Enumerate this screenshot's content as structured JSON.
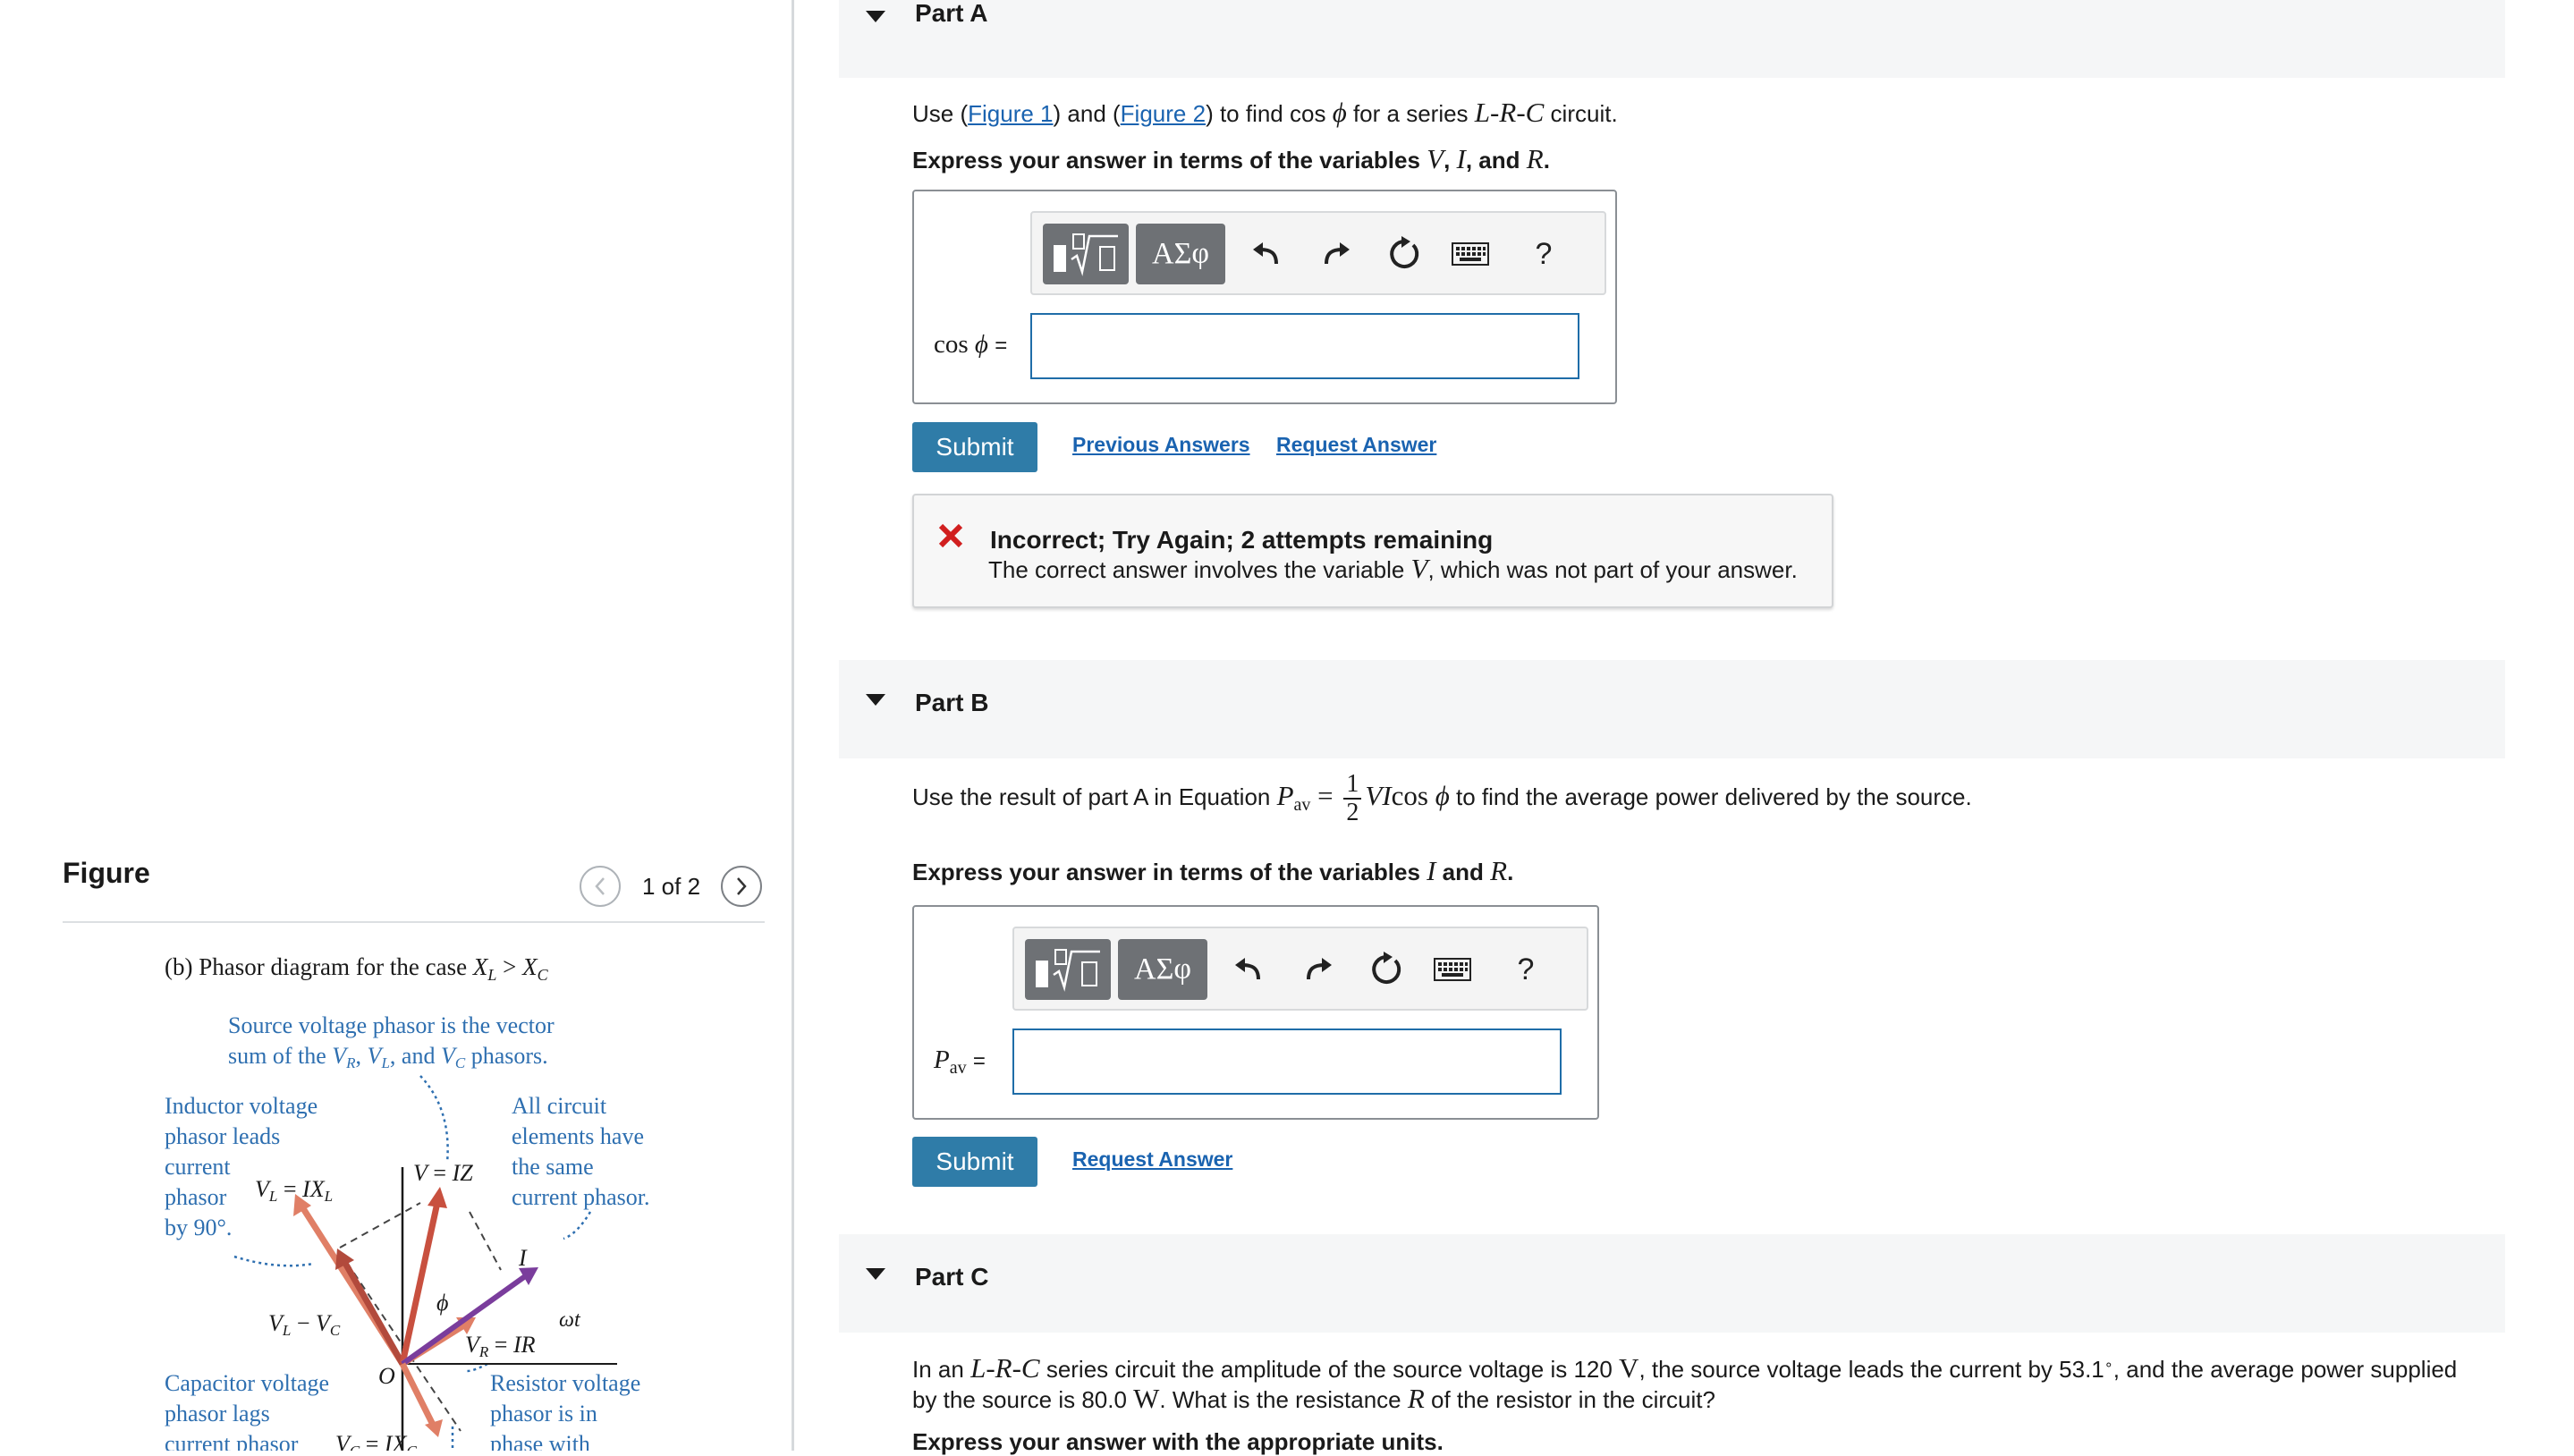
{
  "figure": {
    "title": "Figure",
    "page_count": "1 of 2",
    "caption_prefix": "(b) Phasor diagram for the case ",
    "caption_math": "X_L > X_C",
    "source_note_line1": "Source voltage phasor is the vector",
    "source_note_line2": "sum of the V_R, V_L, and V_C phasors.",
    "inductor_note": [
      "Inductor voltage",
      "phasor leads",
      "current",
      "phasor",
      "by 90°."
    ],
    "all_circuit_note": [
      "All circuit",
      "elements have",
      "the same",
      "current phasor."
    ],
    "capacitor_note": [
      "Capacitor voltage",
      "phasor lags",
      "current phasor"
    ],
    "resistor_note": [
      "Resistor voltage",
      "phasor is in",
      "phase with"
    ],
    "label_VL": "V_L = IX_L",
    "label_V": "V = IZ",
    "label_VLVC": "V_L − V_C",
    "label_VR": "V_R = IR",
    "label_VC": "V_C = IX_C",
    "label_I": "I",
    "label_phi": "ϕ",
    "label_wt": "ωt",
    "label_O": "O"
  },
  "partA": {
    "label": "Part A",
    "question_pre": "Use (",
    "fig1_link": "Figure 1",
    "question_mid": ") and (",
    "fig2_link": "Figure 2",
    "question_post": ") to find cos ϕ for a series L-R-C circuit.",
    "instruction": "Express your answer in terms of the variables V, I, and R.",
    "input_label": "cos ϕ =",
    "input_value": "",
    "submit": "Submit",
    "previous_answers": "Previous Answers",
    "request_answer": "Request Answer",
    "feedback_title": "Incorrect; Try Again; 2 attempts remaining",
    "feedback_msg": "The correct answer involves the variable V, which was not part of your answer."
  },
  "partB": {
    "label": "Part B",
    "question_pre": "Use the result of part A in Equation P",
    "question_post": " to find the average power delivered by the source.",
    "instruction": "Express your answer in terms of the variables I and R.",
    "input_label": "P_av =",
    "input_value": "",
    "submit": "Submit",
    "request_answer": "Request Answer"
  },
  "partC": {
    "label": "Part C",
    "question_line1": "In an L-R-C series circuit the amplitude of the source voltage is 120 V, the source voltage leads the current by 53.1°, and the average power supplied",
    "question_line2": "by the source is 80.0 W. What is the resistance R of the resistor in the circuit?",
    "instruction": "Express your answer with the appropriate units."
  },
  "toolbar": {
    "template_icon": "fraction-radical-template-icon",
    "greek_label": "ΑΣφ",
    "undo_icon": "undo-icon",
    "redo_icon": "redo-icon",
    "reset_icon": "reset-icon",
    "keyboard_icon": "keyboard-icon",
    "help_label": "?"
  },
  "colors": {
    "link": "#1a63b0",
    "submit_bg": "#2f7ca8",
    "input_border": "#1f6da8",
    "error_x": "#d11f1f",
    "figure_text_blue": "#2e6fb0",
    "phasor_salmon": "#e07f66",
    "phasor_purple": "#7a3d9c",
    "phasor_darkred": "#a83a33"
  }
}
